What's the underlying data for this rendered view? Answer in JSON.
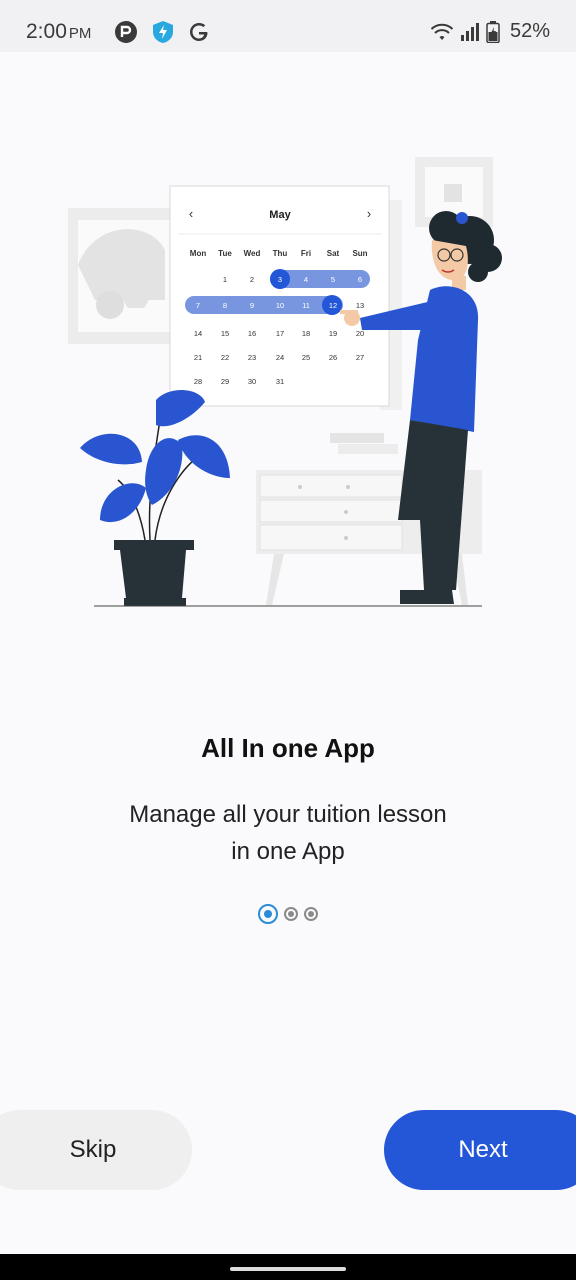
{
  "status_bar": {
    "time": "2:00",
    "ampm": "PM",
    "battery": "52%",
    "icons_left": [
      "record-icon",
      "shield-bolt-icon",
      "google-icon"
    ],
    "icons_right": [
      "wifi-icon",
      "signal-icon",
      "battery-icon"
    ]
  },
  "calendar": {
    "month": "May",
    "weekdays": [
      "Mon",
      "Tue",
      "Wed",
      "Thu",
      "Fri",
      "Sat",
      "Sun"
    ],
    "weeks": [
      [
        "",
        "1",
        "2",
        "3",
        "4",
        "5",
        "6"
      ],
      [
        "7",
        "8",
        "9",
        "10",
        "11",
        "12",
        "13"
      ],
      [
        "14",
        "15",
        "16",
        "17",
        "18",
        "19",
        "20"
      ],
      [
        "21",
        "22",
        "23",
        "24",
        "25",
        "26",
        "27"
      ],
      [
        "28",
        "29",
        "30",
        "31",
        "",
        "",
        ""
      ]
    ],
    "prev_icon": "chevron-left-icon",
    "next_icon": "chevron-right-icon"
  },
  "onboarding": {
    "title": "All In one App",
    "subtitle_line1": "Manage all your tuition lesson",
    "subtitle_line2": "in one App",
    "page_count": 3,
    "active_page": 1
  },
  "buttons": {
    "skip": "Skip",
    "next": "Next"
  },
  "colors": {
    "accent": "#2456d8",
    "dot_active": "#2a8bd8"
  }
}
